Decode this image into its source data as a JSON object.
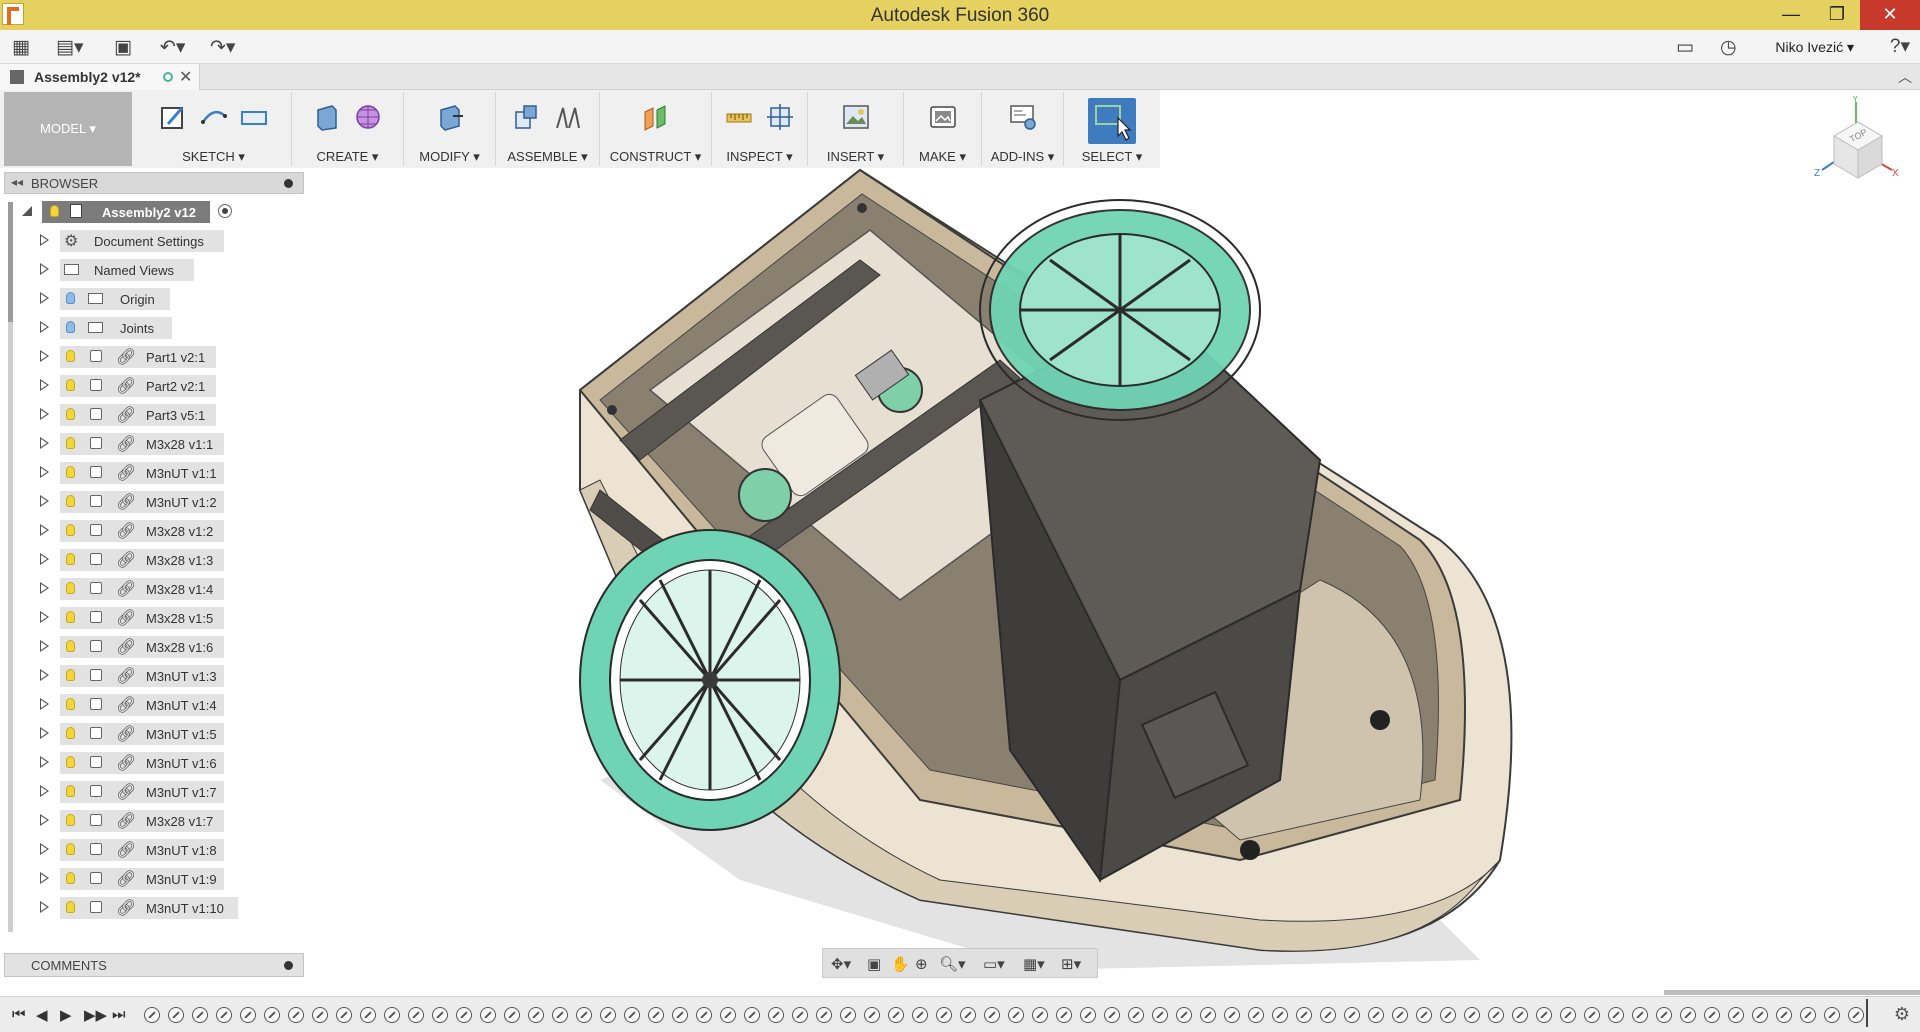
{
  "window": {
    "title": "Autodesk Fusion 360",
    "controls": {
      "minimize": "—",
      "maximize": "❐",
      "close": "✕"
    }
  },
  "qat": {
    "user": "Niko Ivezić ▾",
    "help": "?▾",
    "icons": [
      "grid-menu-icon",
      "file-icon",
      "save-icon",
      "undo-icon",
      "redo-icon",
      "notifications-icon",
      "history-icon"
    ]
  },
  "document_tab": {
    "label": "Assembly2 v12*",
    "close": "✕"
  },
  "ribbon": {
    "workspace": "MODEL ▾",
    "groups": [
      {
        "label": "SKETCH ▾"
      },
      {
        "label": "CREATE ▾"
      },
      {
        "label": "MODIFY ▾"
      },
      {
        "label": "ASSEMBLE ▾"
      },
      {
        "label": "CONSTRUCT ▾"
      },
      {
        "label": "INSPECT ▾"
      },
      {
        "label": "INSERT ▾"
      },
      {
        "label": "MAKE ▾"
      },
      {
        "label": "ADD-INS ▾"
      },
      {
        "label": "SELECT ▾"
      }
    ]
  },
  "viewcube": {
    "face": "TOP",
    "axis_x": "X",
    "axis_y": "Y",
    "axis_z": "Z"
  },
  "browser": {
    "title": "BROWSER",
    "collapse": "◂◂",
    "root": "Assembly2 v12",
    "items": [
      {
        "label": "Document Settings"
      },
      {
        "label": "Named Views"
      },
      {
        "label": "Origin"
      },
      {
        "label": "Joints"
      },
      {
        "label": "Part1 v2:1"
      },
      {
        "label": "Part2 v2:1"
      },
      {
        "label": "Part3 v5:1"
      },
      {
        "label": "M3x28 v1:1"
      },
      {
        "label": "M3nUT v1:1"
      },
      {
        "label": "M3nUT v1:2"
      },
      {
        "label": "M3x28 v1:2"
      },
      {
        "label": "M3x28 v1:3"
      },
      {
        "label": "M3x28 v1:4"
      },
      {
        "label": "M3x28 v1:5"
      },
      {
        "label": "M3x28 v1:6"
      },
      {
        "label": "M3nUT v1:3"
      },
      {
        "label": "M3nUT v1:4"
      },
      {
        "label": "M3nUT v1:5"
      },
      {
        "label": "M3nUT v1:6"
      },
      {
        "label": "M3nUT v1:7"
      },
      {
        "label": "M3x28 v1:7"
      },
      {
        "label": "M3nUT v1:8"
      },
      {
        "label": "M3nUT v1:9"
      },
      {
        "label": "M3nUT v1:10"
      }
    ]
  },
  "comments": {
    "title": "COMMENTS"
  },
  "navbar": {
    "icons": [
      "orbit-icon",
      "look-at-icon",
      "pan-icon",
      "zoom-icon",
      "zoom-window-icon",
      "display-settings-icon",
      "grid-settings-icon",
      "viewports-icon"
    ]
  },
  "timeline": {
    "controls": [
      "⏮",
      "◀",
      "▶",
      "▶▶",
      "⏭"
    ],
    "settings_icon": "⚙"
  },
  "colors": {
    "titlebar": "#e4d160",
    "hull": "#ece3d2",
    "deck": "#8a8070",
    "cabin": "#5e5b57",
    "wheel": "#6fd4b3",
    "select_blue": "#3e7bbf"
  }
}
